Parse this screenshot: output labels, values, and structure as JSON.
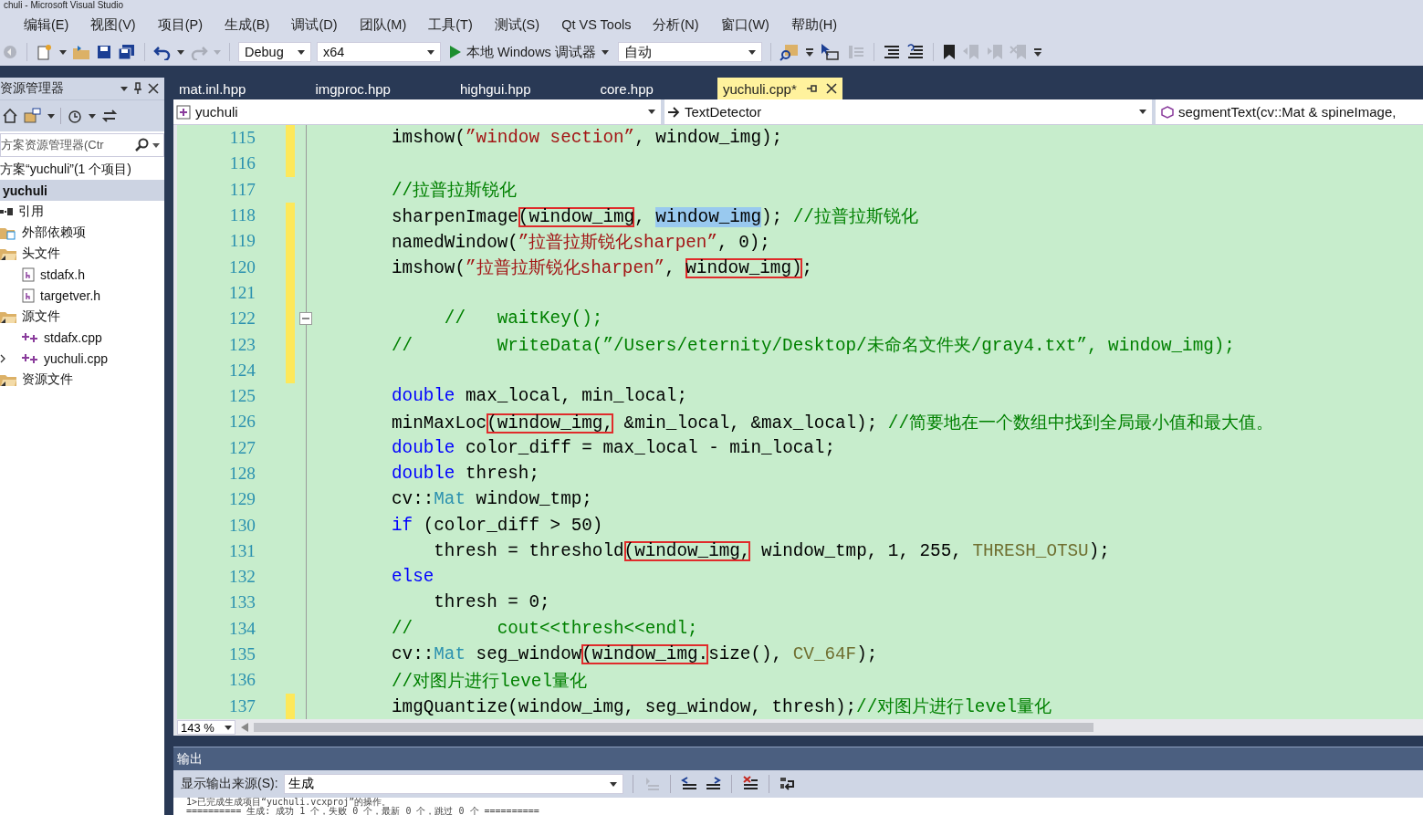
{
  "window": {
    "title": "chuli - Microsoft Visual Studio"
  },
  "menu": [
    "编辑(E)",
    "视图(V)",
    "项目(P)",
    "生成(B)",
    "调试(D)",
    "团队(M)",
    "工具(T)",
    "测试(S)",
    "Qt VS Tools",
    "分析(N)",
    "窗口(W)",
    "帮助(H)"
  ],
  "toolbar": {
    "configuration": "Debug",
    "platform": "x64",
    "run_label": "本地 Windows 调试器",
    "mode": "自动"
  },
  "explorer": {
    "title": "资源管理器",
    "search": {
      "placeholder": "方案资源管理器(Ctr"
    },
    "tree": [
      {
        "label": "方案“yuchuli”(1 个项目)",
        "selected": false,
        "children": [
          {
            "label": "yuchuli",
            "selected": true,
            "children": [
              {
                "label": "引用",
                "kind": "references",
                "selected": false
              },
              {
                "label": "外部依赖项",
                "kind": "external",
                "selected": false
              },
              {
                "label": "头文件",
                "kind": "folder",
                "expanded": true,
                "selected": false,
                "children": [
                  {
                    "label": "stdafx.h",
                    "kind": "header",
                    "selected": false
                  },
                  {
                    "label": "targetver.h",
                    "kind": "header",
                    "selected": false
                  }
                ]
              },
              {
                "label": "源文件",
                "kind": "folder",
                "expanded": true,
                "selected": false,
                "children": [
                  {
                    "label": "stdafx.cpp",
                    "kind": "source",
                    "selected": false
                  },
                  {
                    "label": "yuchuli.cpp",
                    "kind": "source",
                    "expanded": false,
                    "selected": false
                  }
                ]
              },
              {
                "label": "资源文件",
                "kind": "folder",
                "expanded": true,
                "selected": false
              }
            ]
          }
        ]
      }
    ]
  },
  "tabs": [
    {
      "label": "mat.inl.hpp",
      "selected": false
    },
    {
      "label": "imgproc.hpp",
      "selected": false
    },
    {
      "label": "highgui.hpp",
      "selected": false
    },
    {
      "label": "core.hpp",
      "selected": false
    },
    {
      "label": "yuchuli.cpp*",
      "selected": true
    }
  ],
  "navigation": {
    "project": "yuchuli",
    "scope": "TextDetector",
    "member": "segmentText(cv::Mat & spineImage,"
  },
  "code": [
    {
      "number": "115",
      "changed": true,
      "fold_start": false,
      "segments": [
        {
          "kind": "plain",
          "text": "imshow(",
          "boxed": false,
          "selected": false
        },
        {
          "kind": "string",
          "text": "”window section”",
          "boxed": false,
          "selected": false
        },
        {
          "kind": "plain",
          "text": ", window_img);",
          "boxed": false,
          "selected": false
        }
      ]
    },
    {
      "number": "116",
      "changed": true,
      "fold_start": false
    },
    {
      "number": "117",
      "changed": false,
      "fold_start": false,
      "segments": [
        {
          "kind": "comment",
          "text": "//拉普拉斯锐化",
          "boxed": false,
          "selected": false
        }
      ]
    },
    {
      "number": "118",
      "changed": true,
      "fold_start": false,
      "segments": [
        {
          "kind": "plain",
          "text": "sharpenImage",
          "boxed": false,
          "selected": false
        },
        {
          "kind": "plain",
          "text": "(window_img",
          "boxed": true,
          "selected": false
        },
        {
          "kind": "plain",
          "text": ", ",
          "boxed": false,
          "selected": false
        },
        {
          "kind": "plain",
          "text": "window_img",
          "boxed": false,
          "selected": true
        },
        {
          "kind": "plain",
          "text": "); ",
          "boxed": false,
          "selected": false
        },
        {
          "kind": "comment",
          "text": "//拉普拉斯锐化",
          "boxed": false,
          "selected": false
        }
      ]
    },
    {
      "number": "119",
      "changed": true,
      "fold_start": false,
      "segments": [
        {
          "kind": "plain",
          "text": "namedWindow(",
          "boxed": false,
          "selected": false
        },
        {
          "kind": "string",
          "text": "”拉普拉斯锐化sharpen”",
          "boxed": false,
          "selected": false
        },
        {
          "kind": "plain",
          "text": ", 0);",
          "boxed": false,
          "selected": false
        }
      ]
    },
    {
      "number": "120",
      "changed": true,
      "fold_start": false,
      "segments": [
        {
          "kind": "plain",
          "text": "imshow(",
          "boxed": false,
          "selected": false
        },
        {
          "kind": "string",
          "text": "”拉普拉斯锐化sharpen”",
          "boxed": false,
          "selected": false
        },
        {
          "kind": "plain",
          "text": ", ",
          "boxed": false,
          "selected": false
        },
        {
          "kind": "plain",
          "text": "window_img)",
          "boxed": true,
          "selected": false
        },
        {
          "kind": "plain",
          "text": ";",
          "boxed": false,
          "selected": false
        }
      ]
    },
    {
      "number": "121",
      "changed": true,
      "fold_start": false
    },
    {
      "number": "122",
      "changed": true,
      "fold_start": true,
      "segments": [
        {
          "kind": "comment",
          "text": "     //   waitKey();",
          "boxed": false,
          "selected": false
        }
      ]
    },
    {
      "number": "123",
      "changed": true,
      "fold_start": false,
      "segments": [
        {
          "kind": "comment",
          "text": "//        WriteData(”/Users/eternity/Desktop/未命名文件夹/gray4.txt”, window_img);",
          "boxed": false,
          "selected": false
        }
      ]
    },
    {
      "number": "124",
      "changed": true,
      "fold_start": false
    },
    {
      "number": "125",
      "changed": false,
      "fold_start": false,
      "segments": [
        {
          "kind": "keyword",
          "text": "double",
          "boxed": false,
          "selected": false
        },
        {
          "kind": "plain",
          "text": " max_local, min_local;",
          "boxed": false,
          "selected": false
        }
      ]
    },
    {
      "number": "126",
      "changed": false,
      "fold_start": false,
      "segments": [
        {
          "kind": "plain",
          "text": "minMaxLoc",
          "boxed": false,
          "selected": false
        },
        {
          "kind": "plain",
          "text": "(window_img,",
          "boxed": true,
          "selected": false
        },
        {
          "kind": "plain",
          "text": " &min_local, &max_local); ",
          "boxed": false,
          "selected": false
        },
        {
          "kind": "comment",
          "text": "//简要地在一个数组中找到全局最小值和最大值。",
          "boxed": false,
          "selected": false
        }
      ]
    },
    {
      "number": "127",
      "changed": false,
      "fold_start": false,
      "segments": [
        {
          "kind": "keyword",
          "text": "double",
          "boxed": false,
          "selected": false
        },
        {
          "kind": "plain",
          "text": " color_diff = max_local - min_local;",
          "boxed": false,
          "selected": false
        }
      ]
    },
    {
      "number": "128",
      "changed": false,
      "fold_start": false,
      "segments": [
        {
          "kind": "keyword",
          "text": "double",
          "boxed": false,
          "selected": false
        },
        {
          "kind": "plain",
          "text": " thresh;",
          "boxed": false,
          "selected": false
        }
      ]
    },
    {
      "number": "129",
      "changed": false,
      "fold_start": false,
      "segments": [
        {
          "kind": "plain",
          "text": "cv::",
          "boxed": false,
          "selected": false
        },
        {
          "kind": "type",
          "text": "Mat",
          "boxed": false,
          "selected": false
        },
        {
          "kind": "plain",
          "text": " window_tmp;",
          "boxed": false,
          "selected": false
        }
      ]
    },
    {
      "number": "130",
      "changed": false,
      "fold_start": false,
      "segments": [
        {
          "kind": "keyword",
          "text": "if",
          "boxed": false,
          "selected": false
        },
        {
          "kind": "plain",
          "text": " (color_diff > 50)",
          "boxed": false,
          "selected": false
        }
      ]
    },
    {
      "number": "131",
      "changed": false,
      "fold_start": false,
      "segments": [
        {
          "kind": "plain",
          "text": "    thresh = threshold",
          "boxed": false,
          "selected": false
        },
        {
          "kind": "plain",
          "text": "(window_img,",
          "boxed": true,
          "selected": false
        },
        {
          "kind": "plain",
          "text": " window_tmp, 1, 255, ",
          "boxed": false,
          "selected": false
        },
        {
          "kind": "macro",
          "text": "THRESH_OTSU",
          "boxed": false,
          "selected": false
        },
        {
          "kind": "plain",
          "text": ");",
          "boxed": false,
          "selected": false
        }
      ]
    },
    {
      "number": "132",
      "changed": false,
      "fold_start": false,
      "segments": [
        {
          "kind": "keyword",
          "text": "else",
          "boxed": false,
          "selected": false
        }
      ]
    },
    {
      "number": "133",
      "changed": false,
      "fold_start": false,
      "segments": [
        {
          "kind": "plain",
          "text": "    thresh = 0;",
          "boxed": false,
          "selected": false
        }
      ]
    },
    {
      "number": "134",
      "changed": false,
      "fold_start": false,
      "segments": [
        {
          "kind": "comment",
          "text": "//        cout<<thresh<<endl;",
          "boxed": false,
          "selected": false
        }
      ]
    },
    {
      "number": "135",
      "changed": false,
      "fold_start": false,
      "segments": [
        {
          "kind": "plain",
          "text": "cv::",
          "boxed": false,
          "selected": false
        },
        {
          "kind": "type",
          "text": "Mat",
          "boxed": false,
          "selected": false
        },
        {
          "kind": "plain",
          "text": " seg_window",
          "boxed": false,
          "selected": false
        },
        {
          "kind": "plain",
          "text": "(window_img.",
          "boxed": true,
          "selected": false
        },
        {
          "kind": "plain",
          "text": "size(), ",
          "boxed": false,
          "selected": false
        },
        {
          "kind": "macro",
          "text": "CV_64F",
          "boxed": false,
          "selected": false
        },
        {
          "kind": "plain",
          "text": ");",
          "boxed": false,
          "selected": false
        }
      ]
    },
    {
      "number": "136",
      "changed": false,
      "fold_start": false,
      "segments": [
        {
          "kind": "comment",
          "text": "//对图片进行level量化",
          "boxed": false,
          "selected": false
        }
      ]
    },
    {
      "number": "137",
      "changed": true,
      "fold_start": false,
      "segments": [
        {
          "kind": "plain",
          "text": "imgQuantize(window_img, seg_window, thresh);",
          "boxed": false,
          "selected": false
        },
        {
          "kind": "comment",
          "text": "//对图片进行level量化",
          "boxed": false,
          "selected": false
        }
      ]
    }
  ],
  "zoom": "143 %",
  "output": {
    "title": "输出",
    "source_label": "显示输出来源(S):",
    "source": "生成",
    "lines": [
      "1>已完成生成项目“yuchuli.vcxproj”的操作。",
      "========== 生成: 成功 1 个，失败 0 个，最新 0 个，跳过 0 个 =========="
    ]
  }
}
